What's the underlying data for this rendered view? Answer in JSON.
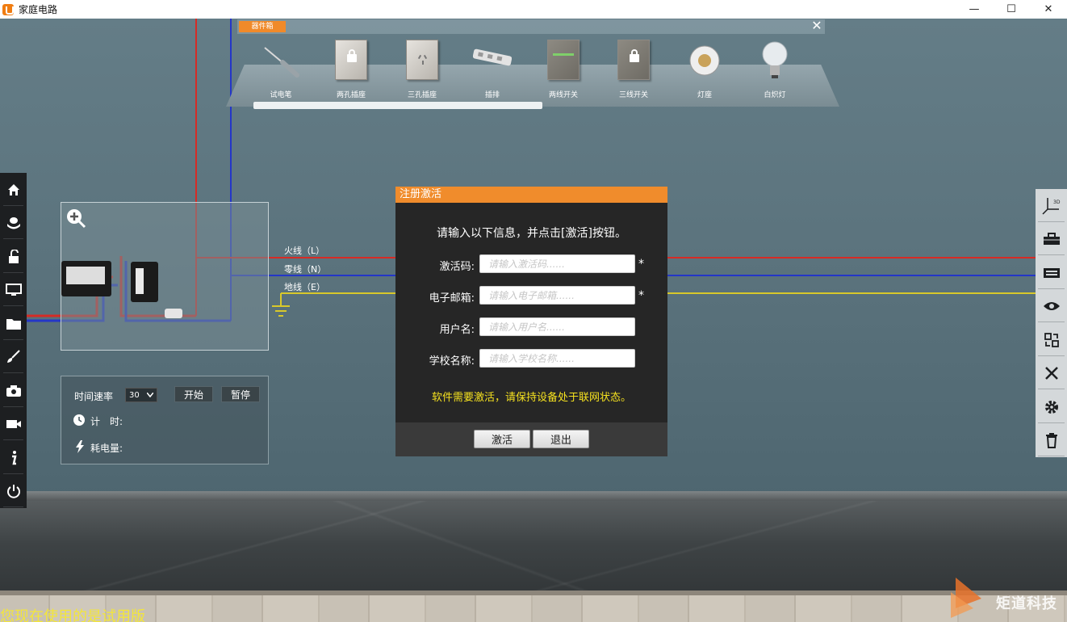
{
  "window": {
    "title": "家庭电路",
    "minimize": "—",
    "maximize": "☐",
    "close": "✕",
    "accent": "#f07d12"
  },
  "toolbox": {
    "tab_label": "器件箱",
    "close": "✕",
    "items": [
      {
        "label": "试电笔",
        "icon": "test-pen-icon"
      },
      {
        "label": "两孔插座",
        "icon": "two-hole-socket-icon"
      },
      {
        "label": "三孔插座",
        "icon": "three-hole-socket-icon"
      },
      {
        "label": "插排",
        "icon": "power-strip-icon"
      },
      {
        "label": "两线开关",
        "icon": "two-wire-switch-icon"
      },
      {
        "label": "三线开关",
        "icon": "three-wire-switch-icon"
      },
      {
        "label": "灯座",
        "icon": "lamp-holder-icon"
      },
      {
        "label": "白炽灯",
        "icon": "incandescent-bulb-icon"
      }
    ]
  },
  "left_sidebar": [
    "home-icon",
    "component-box-icon",
    "unlock-icon",
    "monitor-icon",
    "folder-icon",
    "brush-icon",
    "camera-icon",
    "video-icon",
    "info-icon",
    "power-icon"
  ],
  "right_sidebar": [
    "3d-axis-icon",
    "toolbox-icon",
    "meter-panel-icon",
    "eye-icon",
    "swap-icon",
    "wire-cutter-icon",
    "settings-icon",
    "trash-icon"
  ],
  "right_sidebar_axis_label": "3D",
  "wires": {
    "live": {
      "label": "火线（L）",
      "color": "#d62b25"
    },
    "neutral": {
      "label": "零线（N）",
      "color": "#2436c8"
    },
    "earth": {
      "label": "地线（E）",
      "color": "#d8c82a"
    }
  },
  "timer": {
    "speed_label": "时间速率",
    "speed_value": "30",
    "start": "开始",
    "pause": "暂停",
    "timing_label": "计　时:",
    "energy_label": "耗电量:"
  },
  "dialog": {
    "title": "注册激活",
    "instruction": "请输入以下信息，并点击[激活]按钮。",
    "fields": [
      {
        "label": "激活码:",
        "placeholder": "请输入激活码......",
        "required": "*"
      },
      {
        "label": "电子邮箱:",
        "placeholder": "请输入电子邮箱......",
        "required": "*"
      },
      {
        "label": "用户名:",
        "placeholder": "请输入用户名......",
        "required": ""
      },
      {
        "label": "学校名称:",
        "placeholder": "请输入学校名称......",
        "required": ""
      }
    ],
    "note": "软件需要激活，请保持设备处于联网状态。",
    "activate": "激活",
    "exit": "退出",
    "accent": "#f08c2c"
  },
  "footer": {
    "trial": "您现在使用的是试用版",
    "brand": "矩道科技"
  }
}
